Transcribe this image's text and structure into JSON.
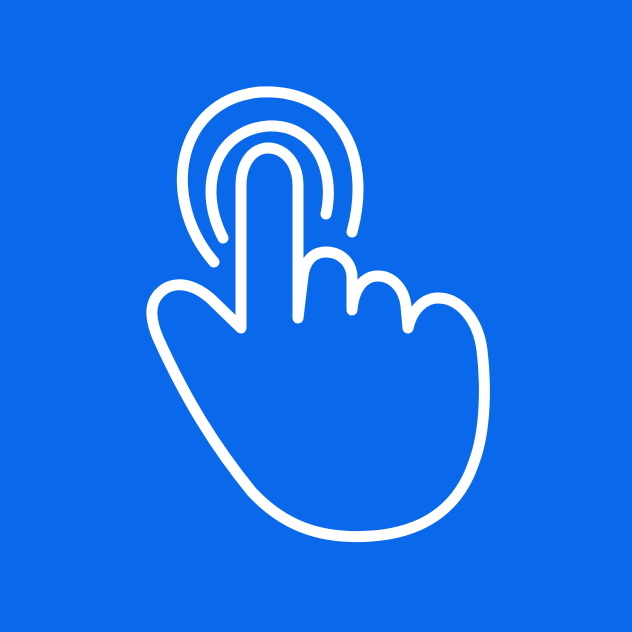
{
  "tile": {
    "icon": "tap-gesture-icon",
    "background_color": "#0a69ea",
    "foreground_color": "#ffffff"
  }
}
